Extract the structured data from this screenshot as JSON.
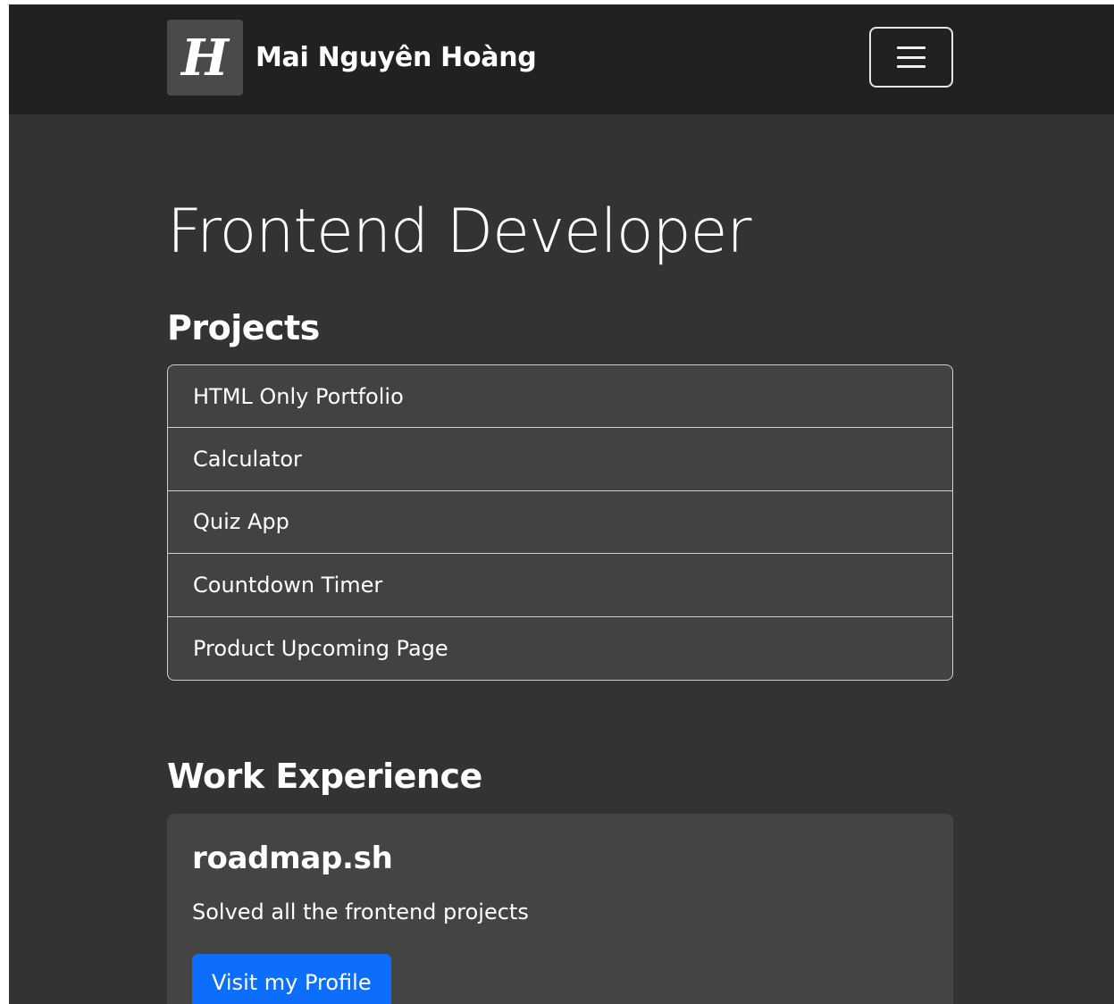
{
  "navbar": {
    "logo_letter": "H",
    "brand_name": "Mai Nguyên Hoàng",
    "toggler_icon": "hamburger-menu-icon"
  },
  "main": {
    "title": "Frontend Developer",
    "projects": {
      "heading": "Projects",
      "items": [
        {
          "label": "HTML Only Portfolio"
        },
        {
          "label": "Calculator"
        },
        {
          "label": "Quiz App"
        },
        {
          "label": "Countdown Timer"
        },
        {
          "label": "Product Upcoming Page"
        }
      ]
    },
    "work": {
      "heading": "Work Experience",
      "card": {
        "title": "roadmap.sh",
        "text": "Solved all the frontend projects",
        "button_label": "Visit my Profile"
      }
    }
  },
  "colors": {
    "navbar_bg": "#212121",
    "page_bg": "#333333",
    "list_bg": "#424242",
    "primary_button": "#0d6efd"
  }
}
